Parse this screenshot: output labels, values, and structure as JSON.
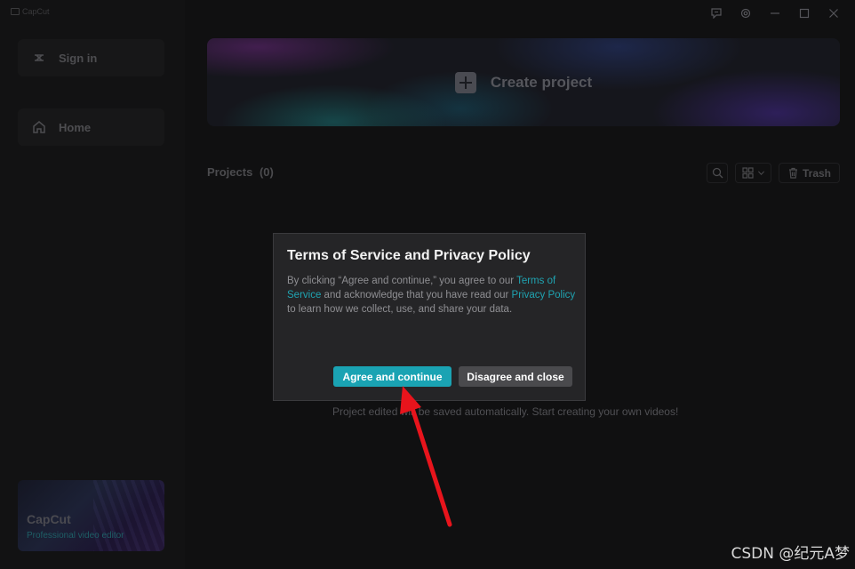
{
  "app": {
    "name": "CapCut"
  },
  "sidebar": {
    "sign_in": "Sign in",
    "home": "Home",
    "promo": {
      "title": "CapCut",
      "subtitle": "Professional video editor"
    }
  },
  "main": {
    "create_project": "Create project",
    "projects_label": "Projects",
    "projects_count": "(0)",
    "trash": "Trash",
    "empty_message": "Project edited will be saved automatically. Start creating your own videos!"
  },
  "modal": {
    "title": "Terms of Service and Privacy Policy",
    "body_1": "By clicking “Agree and continue,” you agree to our",
    "link_terms": "Terms of Service",
    "body_2": " and acknowledge that you have read our ",
    "link_privacy": "Privacy Policy",
    "body_3": " to learn how we collect, use, and share your data.",
    "agree_button": "Agree and continue",
    "disagree_button": "Disagree and close"
  },
  "annotation": {
    "arrow_color": "#e8141c"
  },
  "watermark": "CSDN @纪元A梦",
  "colors": {
    "accent": "#1aa3b3",
    "background": "#101011",
    "modal": "#252527"
  },
  "icons": [
    "capcut-logo-icon",
    "sign-in-icon",
    "home-icon",
    "feedback-icon",
    "settings-icon",
    "minimize-icon",
    "maximize-icon",
    "close-icon",
    "plus-icon",
    "search-icon",
    "grid-view-icon",
    "chevron-down-icon",
    "trash-icon"
  ]
}
